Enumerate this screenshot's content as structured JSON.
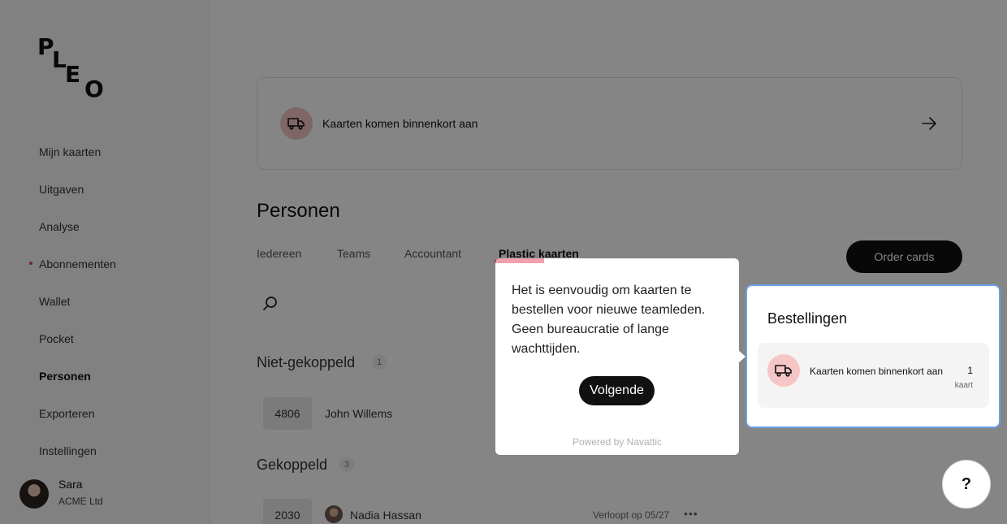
{
  "brand": {
    "logo_letters": [
      "P",
      "L",
      "E",
      "O"
    ]
  },
  "sidebar": {
    "items": [
      {
        "label": "Mijn kaarten"
      },
      {
        "label": "Uitgaven"
      },
      {
        "label": "Analyse"
      },
      {
        "label": "Abonnementen",
        "dot": true
      },
      {
        "label": "Wallet"
      },
      {
        "label": "Pocket"
      },
      {
        "label": "Personen",
        "active": true
      },
      {
        "label": "Exporteren"
      },
      {
        "label": "Instellingen"
      }
    ],
    "user": {
      "name": "Sara",
      "org": "ACME Ltd"
    }
  },
  "banner": {
    "text": "Kaarten komen binnenkort aan",
    "icon": "truck-icon",
    "arrow_icon": "arrow-right-icon"
  },
  "main": {
    "title": "Personen",
    "tabs": [
      {
        "label": "Iedereen"
      },
      {
        "label": "Teams"
      },
      {
        "label": "Accountant"
      },
      {
        "label": "Plastic kaarten",
        "active": true
      }
    ],
    "order_button": "Order cards",
    "sections": {
      "unlinked": {
        "title": "Niet-gekoppeld",
        "count": "1",
        "row": {
          "card": "4806",
          "name": "John Willems"
        }
      },
      "linked": {
        "title": "Gekoppeld",
        "count": "3",
        "row": {
          "card": "2030",
          "name": "Nadia Hassan",
          "expiry": "Verloopt op 05/27",
          "more": "•••"
        }
      }
    }
  },
  "tooltip": {
    "text": "Het is eenvoudig om kaarten te bestellen voor nieuwe teamleden. Geen bureaucratie of lange wachttijden.",
    "next_button": "Volgende",
    "powered": "Powered by Navattic"
  },
  "orders_panel": {
    "title": "Bestellingen",
    "row": {
      "text": "Kaarten komen binnenkort aan",
      "count": "1",
      "unit": "kaart"
    }
  },
  "help": {
    "label": "?"
  },
  "colors": {
    "accent": "#d9485f",
    "truck_bg": "#f6c6c6",
    "highlight_border": "#6aa0e8",
    "button_dark": "#111111"
  }
}
